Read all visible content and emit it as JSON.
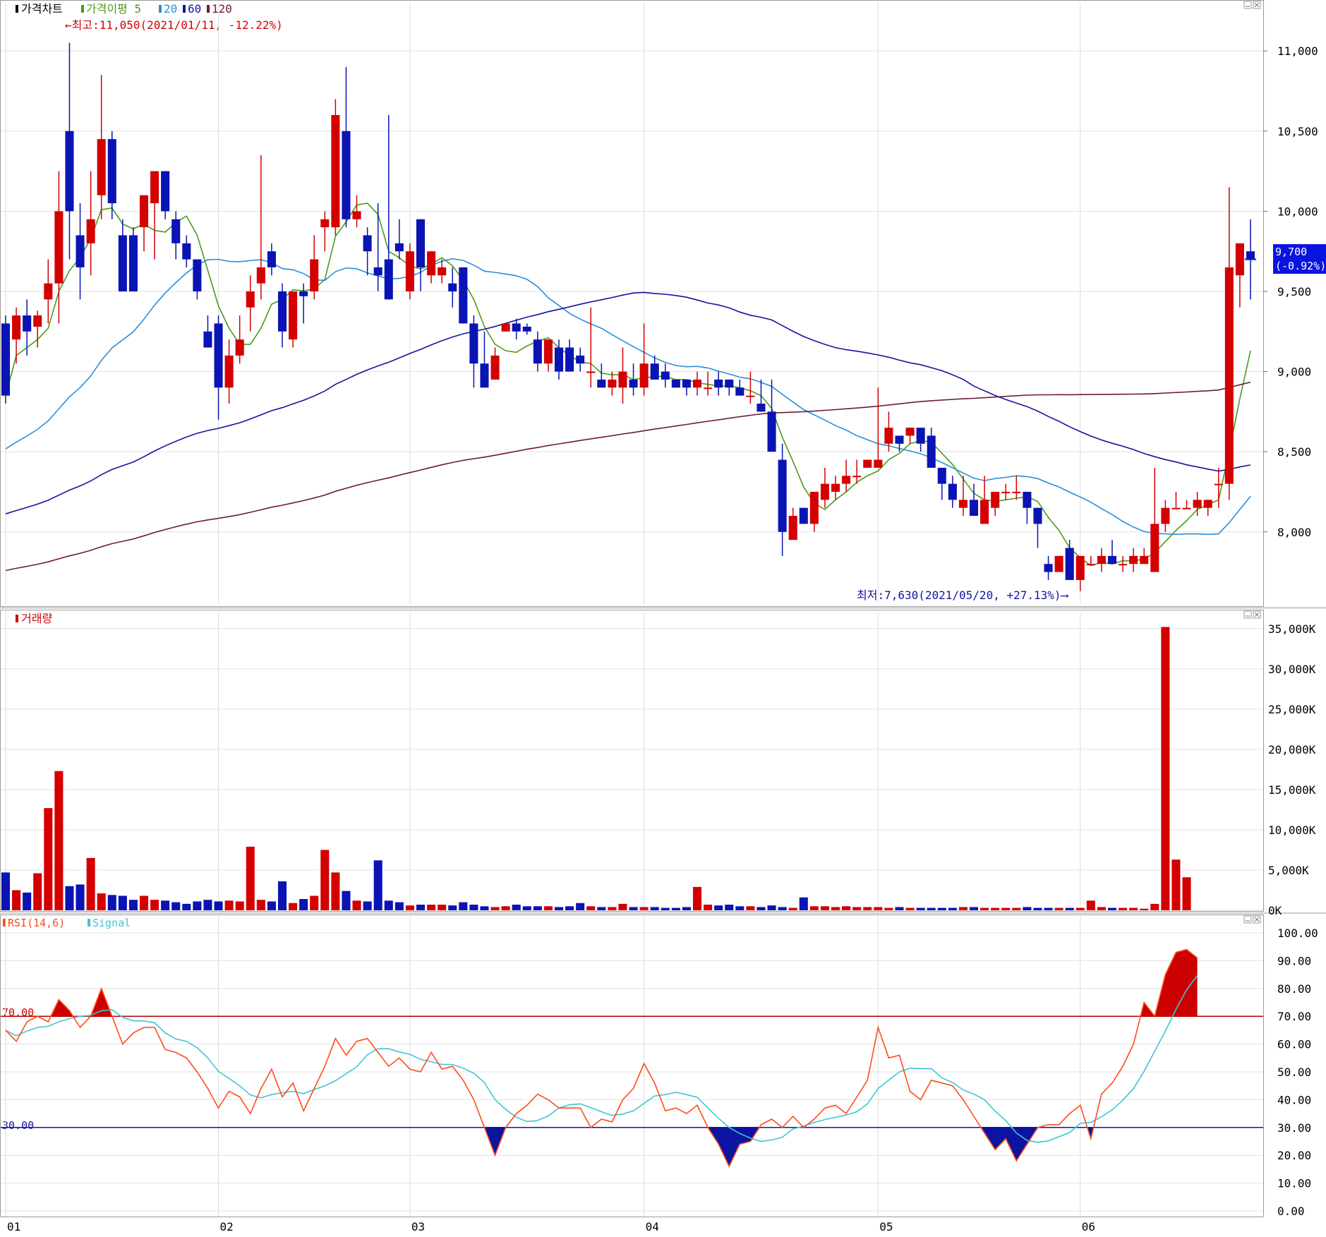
{
  "panels": {
    "price": {
      "legend": [
        {
          "text": "가격차트",
          "color": "#000000"
        },
        {
          "text": "가격이평 5",
          "color": "#4c9a1c"
        },
        {
          "text": "20",
          "color": "#2a8fd6"
        },
        {
          "text": "60",
          "color": "#1414a0"
        },
        {
          "text": "120",
          "color": "#6e1a3a"
        }
      ],
      "high_note": "←최고:11,050(2021/01/11, -12.22%)",
      "low_note": "최저:7,630(2021/05/20, +27.13%)⟶",
      "current_price": "9,700",
      "current_change": "(-0.92%)",
      "yticks": [
        "11,000",
        "10,500",
        "10,000",
        "9,500",
        "9,000",
        "8,500",
        "8,000"
      ]
    },
    "volume": {
      "legend": [
        {
          "text": "거래량",
          "color": "#d40000"
        }
      ],
      "yticks": [
        "35,000K",
        "30,000K",
        "25,000K",
        "20,000K",
        "15,000K",
        "10,000K",
        "5,000K",
        "0K"
      ]
    },
    "rsi": {
      "legend": [
        {
          "text": "RSI(14,6)",
          "color": "#ff4a1a"
        },
        {
          "text": "Signal",
          "color": "#3ec6d6"
        }
      ],
      "level_high": "70.00",
      "level_low": "30.00",
      "yticks": [
        "100.00",
        "90.00",
        "80.00",
        "70.00",
        "60.00",
        "50.00",
        "40.00",
        "30.00",
        "20.00",
        "10.00",
        "0.00"
      ]
    }
  },
  "xaxis": {
    "labels": [
      "01",
      "02",
      "03",
      "04",
      "05",
      "06"
    ]
  },
  "colors": {
    "up": "#d40000",
    "down": "#0a14b4",
    "ma5": "#4c9a1c",
    "ma20": "#2a8fd6",
    "ma60": "#1414a0",
    "ma120": "#6e1a3a",
    "rsi": "#ff4a1a",
    "signal": "#3ec6d6"
  },
  "chart_data": {
    "type": "candlestick",
    "x_month_ticks": [
      {
        "label": "01",
        "index": 0
      },
      {
        "label": "02",
        "index": 20
      },
      {
        "label": "03",
        "index": 38
      },
      {
        "label": "04",
        "index": 60
      },
      {
        "label": "05",
        "index": 82
      },
      {
        "label": "06",
        "index": 101
      }
    ],
    "candles": [
      [
        9300,
        9350,
        8800,
        8850
      ],
      [
        9200,
        9400,
        9050,
        9350
      ],
      [
        9350,
        9450,
        9100,
        9250
      ],
      [
        9280,
        9380,
        9150,
        9350
      ],
      [
        9450,
        9700,
        9300,
        9550
      ],
      [
        9550,
        10250,
        9300,
        10000
      ],
      [
        10500,
        11050,
        9700,
        10000
      ],
      [
        9850,
        10050,
        9450,
        9650
      ],
      [
        9800,
        10250,
        9600,
        9950
      ],
      [
        10100,
        10850,
        9950,
        10450
      ],
      [
        10450,
        10500,
        9950,
        10050
      ],
      [
        9850,
        9950,
        9500,
        9500
      ],
      [
        9850,
        9900,
        9500,
        9500
      ],
      [
        9900,
        10100,
        9750,
        10100
      ],
      [
        10050,
        10250,
        9700,
        10250
      ],
      [
        10250,
        10250,
        9950,
        10000
      ],
      [
        9950,
        10000,
        9700,
        9800
      ],
      [
        9800,
        9850,
        9650,
        9700
      ],
      [
        9700,
        9700,
        9450,
        9500
      ],
      [
        9250,
        9350,
        9200,
        9150
      ],
      [
        9300,
        9350,
        8700,
        8900
      ],
      [
        8900,
        9200,
        8800,
        9100
      ],
      [
        9100,
        9350,
        9050,
        9200
      ],
      [
        9400,
        9600,
        9250,
        9500
      ],
      [
        9550,
        10350,
        9450,
        9650
      ],
      [
        9750,
        9800,
        9600,
        9650
      ],
      [
        9500,
        9550,
        9150,
        9250
      ],
      [
        9200,
        9500,
        9150,
        9500
      ],
      [
        9500,
        9550,
        9300,
        9470
      ],
      [
        9500,
        9850,
        9450,
        9700
      ],
      [
        9900,
        10000,
        9750,
        9950
      ],
      [
        9900,
        10700,
        9850,
        10600
      ],
      [
        10500,
        10900,
        9900,
        9950
      ],
      [
        9950,
        10100,
        9900,
        10000
      ],
      [
        9850,
        9900,
        9600,
        9750
      ],
      [
        9650,
        10050,
        9500,
        9600
      ],
      [
        9700,
        10600,
        9450,
        9450
      ],
      [
        9800,
        9950,
        9700,
        9750
      ],
      [
        9500,
        9800,
        9450,
        9750
      ],
      [
        9950,
        9950,
        9500,
        9650
      ],
      [
        9600,
        9750,
        9550,
        9750
      ],
      [
        9600,
        9700,
        9550,
        9650
      ],
      [
        9550,
        9650,
        9400,
        9500
      ],
      [
        9650,
        9650,
        9300,
        9300
      ],
      [
        9300,
        9350,
        8900,
        9050
      ],
      [
        9050,
        9250,
        8900,
        8900
      ],
      [
        8950,
        9150,
        8950,
        9100
      ],
      [
        9250,
        9300,
        9250,
        9300
      ],
      [
        9300,
        9330,
        9200,
        9250
      ],
      [
        9280,
        9300,
        9230,
        9250
      ],
      [
        9200,
        9250,
        9000,
        9050
      ],
      [
        9050,
        9200,
        9000,
        9200
      ],
      [
        9150,
        9200,
        8950,
        9000
      ],
      [
        9150,
        9200,
        9000,
        9000
      ],
      [
        9100,
        9150,
        9000,
        9050
      ],
      [
        9000,
        9400,
        8900,
        9000
      ],
      [
        8950,
        9050,
        8900,
        8900
      ],
      [
        8900,
        9000,
        8850,
        8950
      ],
      [
        8900,
        9150,
        8800,
        9000
      ],
      [
        8950,
        9050,
        8850,
        8900
      ],
      [
        8900,
        9300,
        8850,
        9050
      ],
      [
        9050,
        9100,
        8950,
        8950
      ],
      [
        9000,
        9050,
        8900,
        8950
      ],
      [
        8950,
        8950,
        8900,
        8900
      ],
      [
        8950,
        8950,
        8850,
        8900
      ],
      [
        8900,
        9000,
        8850,
        8950
      ],
      [
        8900,
        9000,
        8850,
        8900
      ],
      [
        8950,
        9000,
        8850,
        8900
      ],
      [
        8950,
        8950,
        8850,
        8900
      ],
      [
        8900,
        8950,
        8850,
        8850
      ],
      [
        8850,
        9000,
        8800,
        8850
      ],
      [
        8800,
        8950,
        8750,
        8750
      ],
      [
        8750,
        8950,
        8500,
        8500
      ],
      [
        8450,
        8550,
        7850,
        8000
      ],
      [
        7950,
        8150,
        7950,
        8100
      ],
      [
        8150,
        8150,
        8050,
        8050
      ],
      [
        8050,
        8250,
        8000,
        8250
      ],
      [
        8200,
        8400,
        8150,
        8300
      ],
      [
        8250,
        8350,
        8200,
        8300
      ],
      [
        8300,
        8450,
        8250,
        8350
      ],
      [
        8350,
        8450,
        8300,
        8350
      ],
      [
        8400,
        8450,
        8400,
        8450
      ],
      [
        8400,
        8900,
        8400,
        8450
      ],
      [
        8550,
        8750,
        8500,
        8650
      ],
      [
        8600,
        8600,
        8500,
        8550
      ],
      [
        8600,
        8650,
        8550,
        8650
      ],
      [
        8650,
        8650,
        8500,
        8550
      ],
      [
        8600,
        8650,
        8400,
        8400
      ],
      [
        8400,
        8400,
        8200,
        8300
      ],
      [
        8300,
        8350,
        8150,
        8200
      ],
      [
        8150,
        8350,
        8100,
        8200
      ],
      [
        8200,
        8300,
        8100,
        8100
      ],
      [
        8050,
        8350,
        8100,
        8200
      ],
      [
        8150,
        8250,
        8100,
        8250
      ],
      [
        8250,
        8300,
        8200,
        8250
      ],
      [
        8250,
        8350,
        8200,
        8250
      ],
      [
        8250,
        8250,
        8050,
        8150
      ],
      [
        8150,
        8150,
        7900,
        8050
      ],
      [
        7800,
        7850,
        7700,
        7750
      ],
      [
        7750,
        7850,
        7750,
        7850
      ],
      [
        7900,
        7950,
        7700,
        7700
      ],
      [
        7700,
        7750,
        7630,
        7850
      ],
      [
        7800,
        7850,
        7800,
        7800
      ],
      [
        7800,
        7900,
        7750,
        7850
      ],
      [
        7850,
        7950,
        7800,
        7800
      ],
      [
        7800,
        7850,
        7750,
        7800
      ],
      [
        7800,
        7900,
        7750,
        7850
      ],
      [
        7800,
        7900,
        7800,
        7850
      ],
      [
        7750,
        8400,
        7750,
        8050
      ],
      [
        8050,
        8200,
        8000,
        8150
      ],
      [
        8150,
        8250,
        8150,
        8150
      ],
      [
        8150,
        8200,
        8150,
        8150
      ],
      [
        8150,
        8250,
        8100,
        8200
      ],
      [
        8150,
        8200,
        8100,
        8200
      ],
      [
        8300,
        8400,
        8150,
        8300
      ],
      [
        8300,
        10150,
        8200,
        9650
      ],
      [
        9600,
        9800,
        9400,
        9800
      ],
      [
        9750,
        9950,
        9450,
        9700
      ]
    ],
    "volume_k": [
      4700,
      2500,
      2200,
      4600,
      12700,
      17300,
      3000,
      3200,
      6500,
      2100,
      1900,
      1800,
      1300,
      1800,
      1300,
      1200,
      1000,
      800,
      1100,
      1300,
      1100,
      1200,
      1100,
      7900,
      1300,
      1100,
      3600,
      900,
      1400,
      1800,
      7500,
      4700,
      2400,
      1200,
      1100,
      6200,
      1200,
      1000,
      600,
      700,
      700,
      700,
      600,
      1000,
      700,
      500,
      400,
      500,
      700,
      500,
      500,
      500,
      400,
      500,
      900,
      500,
      400,
      400,
      800,
      400,
      400,
      400,
      300,
      300,
      400,
      2900,
      700,
      600,
      700,
      500,
      500,
      400,
      600,
      400,
      300,
      1600,
      500,
      500,
      400,
      500,
      400,
      400,
      400,
      300,
      400,
      300,
      300,
      300,
      300,
      300,
      400,
      400,
      300,
      300,
      300,
      300,
      400,
      300,
      300,
      300,
      300,
      300,
      1200,
      400,
      300,
      300,
      300,
      200,
      800,
      35200,
      6300,
      4100
    ],
    "rsi": [
      65,
      61,
      68,
      70,
      68,
      76,
      72,
      66,
      70,
      80,
      70,
      60,
      64,
      66,
      66,
      58,
      57,
      55,
      50,
      44,
      37,
      43,
      41,
      35,
      44,
      51,
      41,
      46,
      36,
      44,
      52,
      62,
      56,
      61,
      62,
      57,
      52,
      55,
      51,
      50,
      57,
      51,
      52,
      47,
      40,
      30,
      20,
      30,
      35,
      38,
      42,
      40,
      37,
      37,
      37,
      30,
      33,
      32,
      40,
      44,
      53,
      46,
      36,
      37,
      35,
      38,
      30,
      24,
      16,
      24,
      25,
      31,
      33,
      30,
      34,
      30,
      33,
      37,
      38,
      35,
      41,
      47,
      66,
      55,
      56,
      43,
      40,
      47,
      46,
      45,
      40,
      34,
      28,
      22,
      26,
      18,
      24,
      30,
      31,
      31,
      35,
      38,
      26,
      42,
      46,
      52,
      60,
      75,
      70,
      85,
      93,
      94,
      91
    ],
    "ylim": [
      7550,
      11300
    ],
    "volume_ylim": [
      0,
      37000
    ],
    "rsi_ylim": [
      0,
      100
    ]
  }
}
